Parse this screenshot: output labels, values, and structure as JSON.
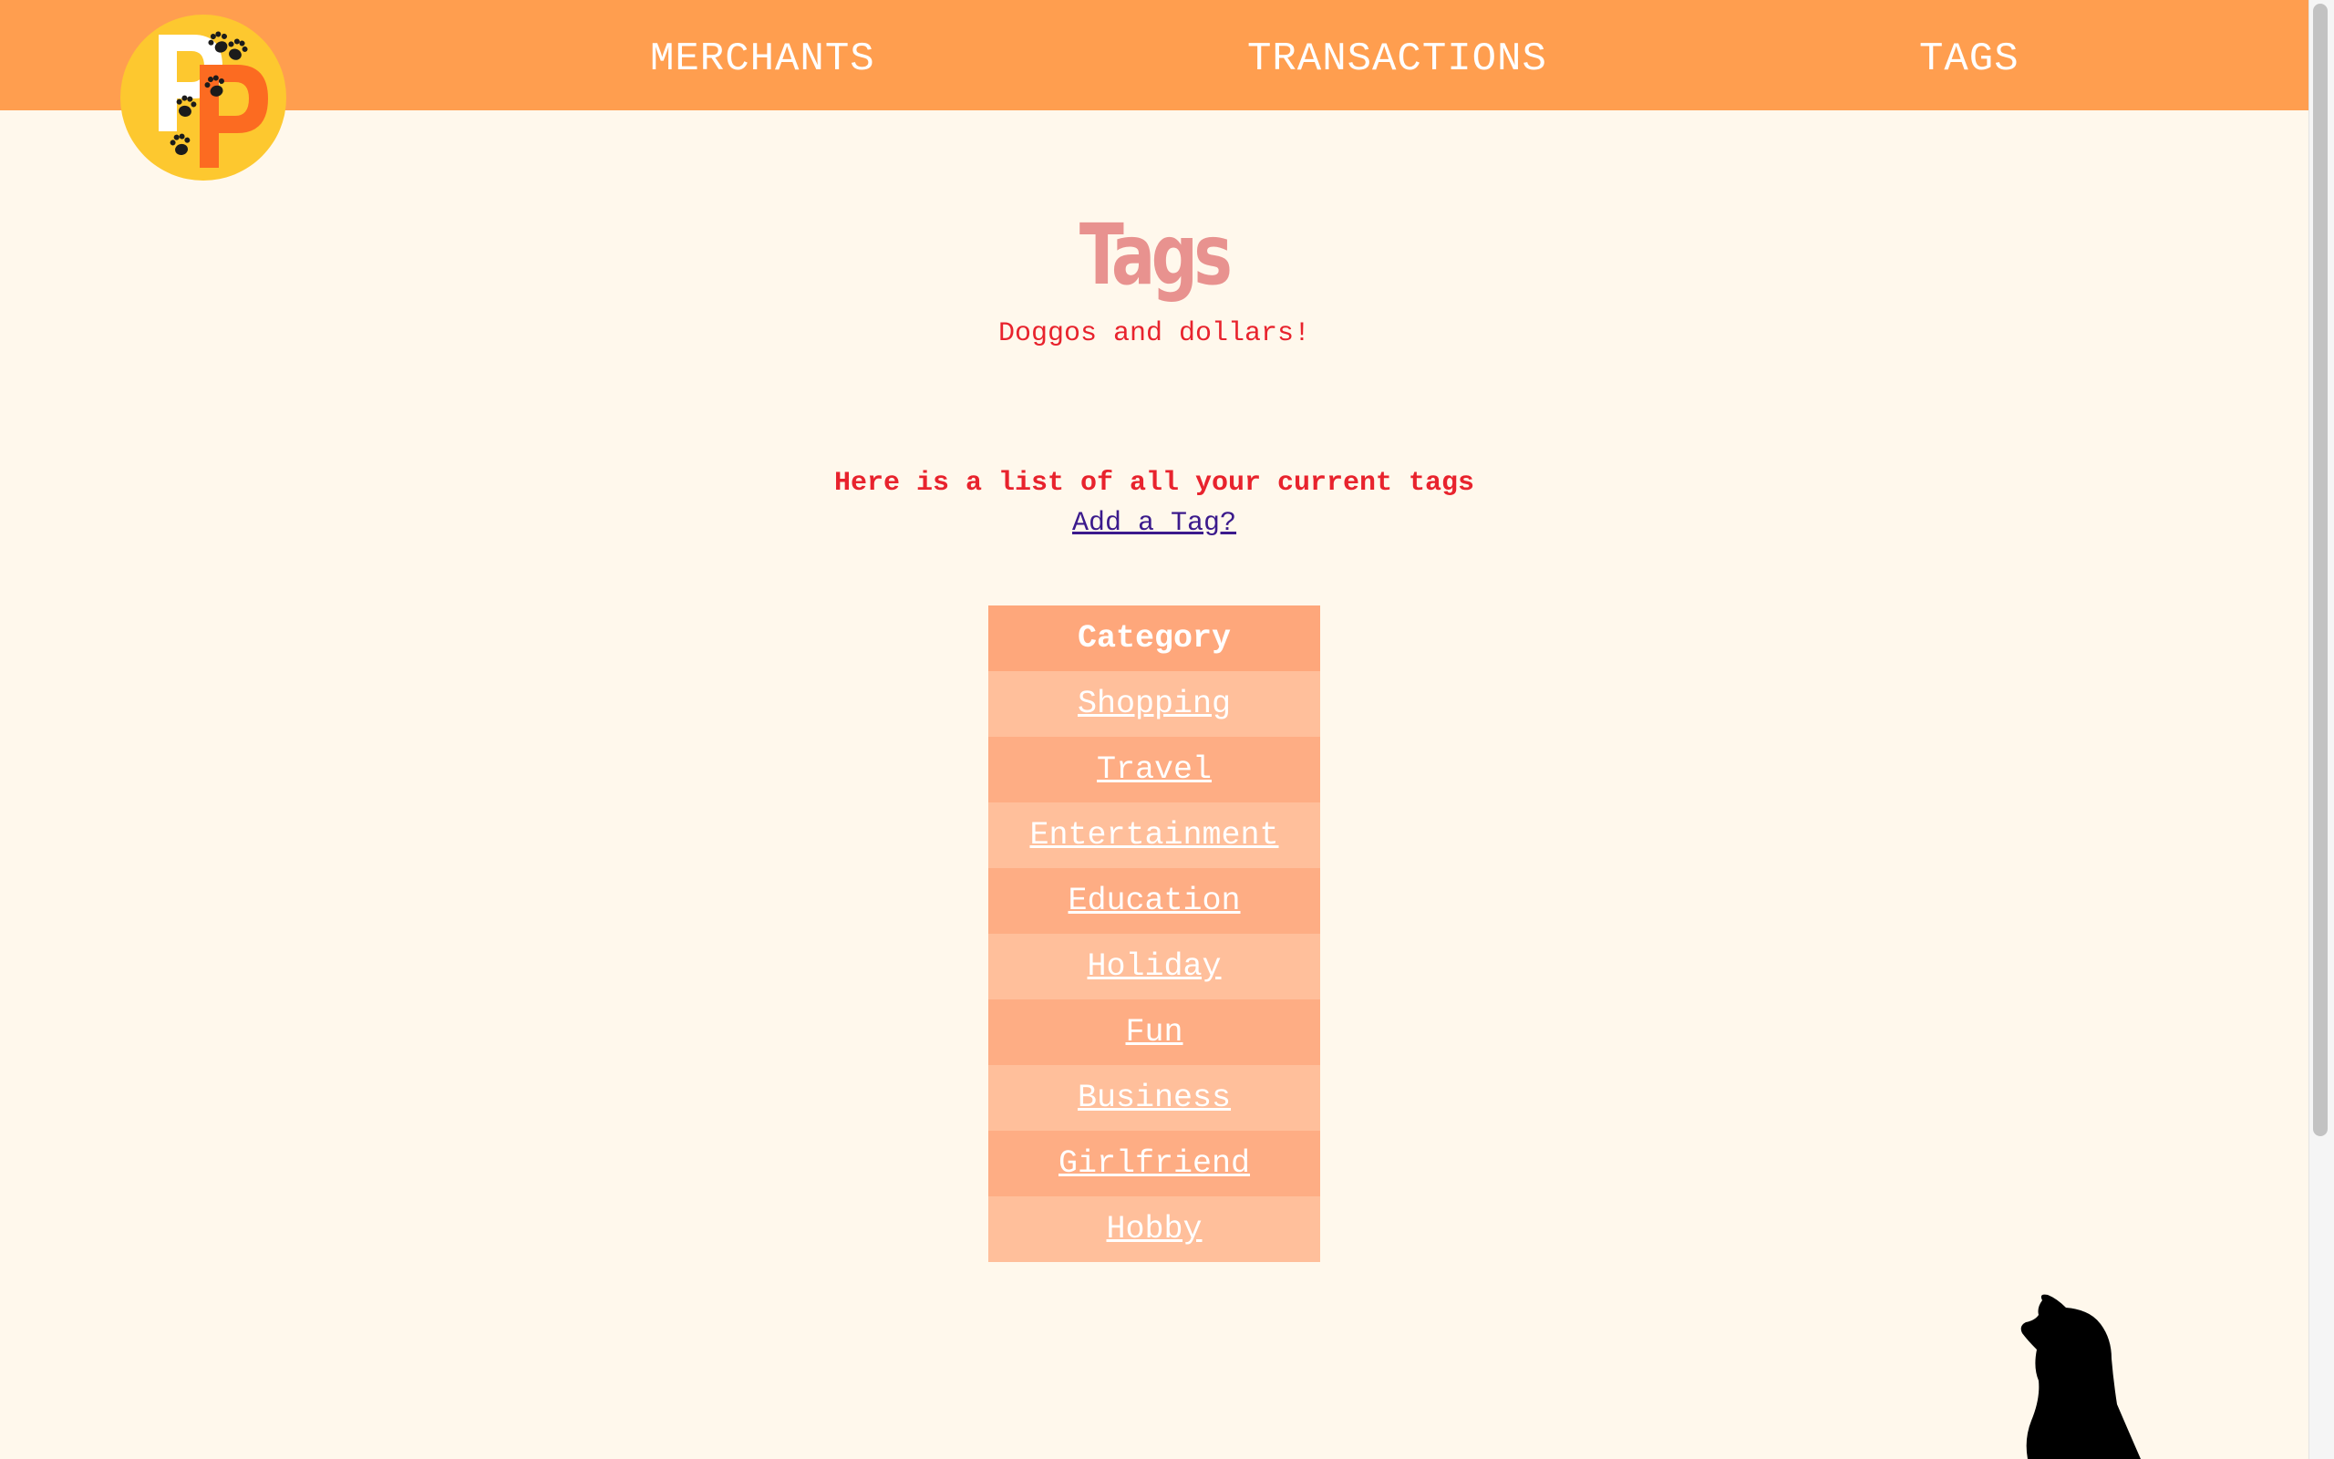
{
  "nav": {
    "merchants": "MERCHANTS",
    "transactions": "TRANSACTIONS",
    "tags": "TAGS"
  },
  "header": {
    "title": "Tags",
    "tagline": "Doggos and dollars!"
  },
  "main": {
    "intro": "Here is a list of all your current tags",
    "add_link": "Add a Tag?"
  },
  "table": {
    "header": "Category",
    "rows": [
      "Shopping",
      "Travel",
      "Entertainment",
      "Education",
      "Holiday",
      "Fun",
      "Business",
      "Girlfriend",
      "Hobby"
    ]
  },
  "colors": {
    "nav_bg": "#ff9e4f",
    "page_bg": "#fff8ec",
    "title": "#e8928f",
    "text_red": "#e8232d",
    "row_light": "#ffbf9b",
    "row_dark": "#fead84"
  },
  "icons": {
    "logo": "pp-paw-logo",
    "dog": "dog-silhouette-icon"
  }
}
